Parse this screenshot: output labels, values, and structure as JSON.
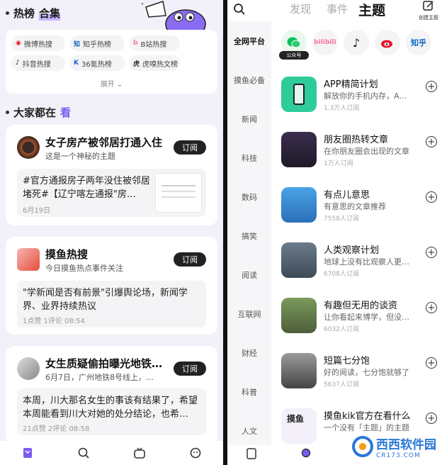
{
  "left": {
    "hot_title_plain": "热榜",
    "hot_title_hl": "合集",
    "hot_chips": [
      {
        "label": "微博热搜",
        "icon": "weibo-icon"
      },
      {
        "label": "知乎热榜",
        "icon": "zhihu-icon"
      },
      {
        "label": "B站热搜",
        "icon": "bilibili-icon"
      },
      {
        "label": "抖音热搜",
        "icon": "douyin-icon"
      },
      {
        "label": "36氪热榜",
        "icon": "36kr-icon"
      },
      {
        "label": "虎嗅热文榜",
        "icon": "huxiu-icon"
      }
    ],
    "expand_label": "展开",
    "see_title_plain": "大家都在",
    "see_title_accent": "看",
    "cards": [
      {
        "title": "女子房产被邻居打通入住",
        "subtitle": "这是一个神秘的主题",
        "button": "订阅",
        "body": "#官方通报房子两年没住被邻居堵死#【辽宁喀左通报\"房…",
        "meta": "6月19日"
      },
      {
        "title": "摸鱼热搜",
        "subtitle": "今日摸鱼热点事件关注",
        "button": "订阅",
        "body": "\"学新闻是否有前景\"引爆舆论场，新闻学界、业界持续热议",
        "meta": "1点赞  1评论  08:54"
      },
      {
        "title": "女生质疑偷拍曝光地铁…",
        "subtitle": "6月7日，广州地铁8号线上，…",
        "button": "订阅",
        "body": "本周，川大那名女生的事该有结果了，希望本周能看到川大对她的处分结论，也希…",
        "meta": "21点赞  2评论  08:58"
      }
    ]
  },
  "right": {
    "tabs": [
      "发现",
      "事件",
      "主题"
    ],
    "active_tab": "主题",
    "create_label": "创建主题",
    "sidebar": [
      "全网平台",
      "摸鱼必备",
      "新闻",
      "科技",
      "数码",
      "搞笑",
      "阅读",
      "互联网",
      "财经",
      "科普",
      "人文"
    ],
    "platforms": [
      {
        "label": "公众号",
        "icon": "wechat-icon",
        "text": ""
      },
      {
        "label": "",
        "icon": "bilibili-icon",
        "text": "bilibili"
      },
      {
        "label": "",
        "icon": "douyin-icon",
        "text": "♪"
      },
      {
        "label": "",
        "icon": "weibo-icon",
        "text": ""
      },
      {
        "label": "",
        "icon": "zhihu-icon",
        "text": "知乎"
      }
    ],
    "topics": [
      {
        "title": "APP精简计划",
        "desc": "解放你的手机内存，A…",
        "count": "1.3万人订阅"
      },
      {
        "title": "朋友圈热转文章",
        "desc": "在你朋友圈会出现的文章",
        "count": "1万人订阅"
      },
      {
        "title": "有点儿意思",
        "desc": "有意思的文章推荐",
        "count": "7558人订阅"
      },
      {
        "title": "人类观察计划",
        "desc": "地球上没有比观察人更…",
        "count": "6708人订阅"
      },
      {
        "title": "有趣但无用的谈资",
        "desc": "让你看起来博学，但没…",
        "count": "6032人订阅"
      },
      {
        "title": "短篇七分饱",
        "desc": "好的阅读，七分饱就够了",
        "count": "5637人订阅"
      },
      {
        "title": "摸鱼kik官方在看什么",
        "desc": "一个没有「主题」的主题",
        "count": ""
      }
    ],
    "watermark": "西西软件园",
    "watermark_sub": "CR173.COM"
  }
}
